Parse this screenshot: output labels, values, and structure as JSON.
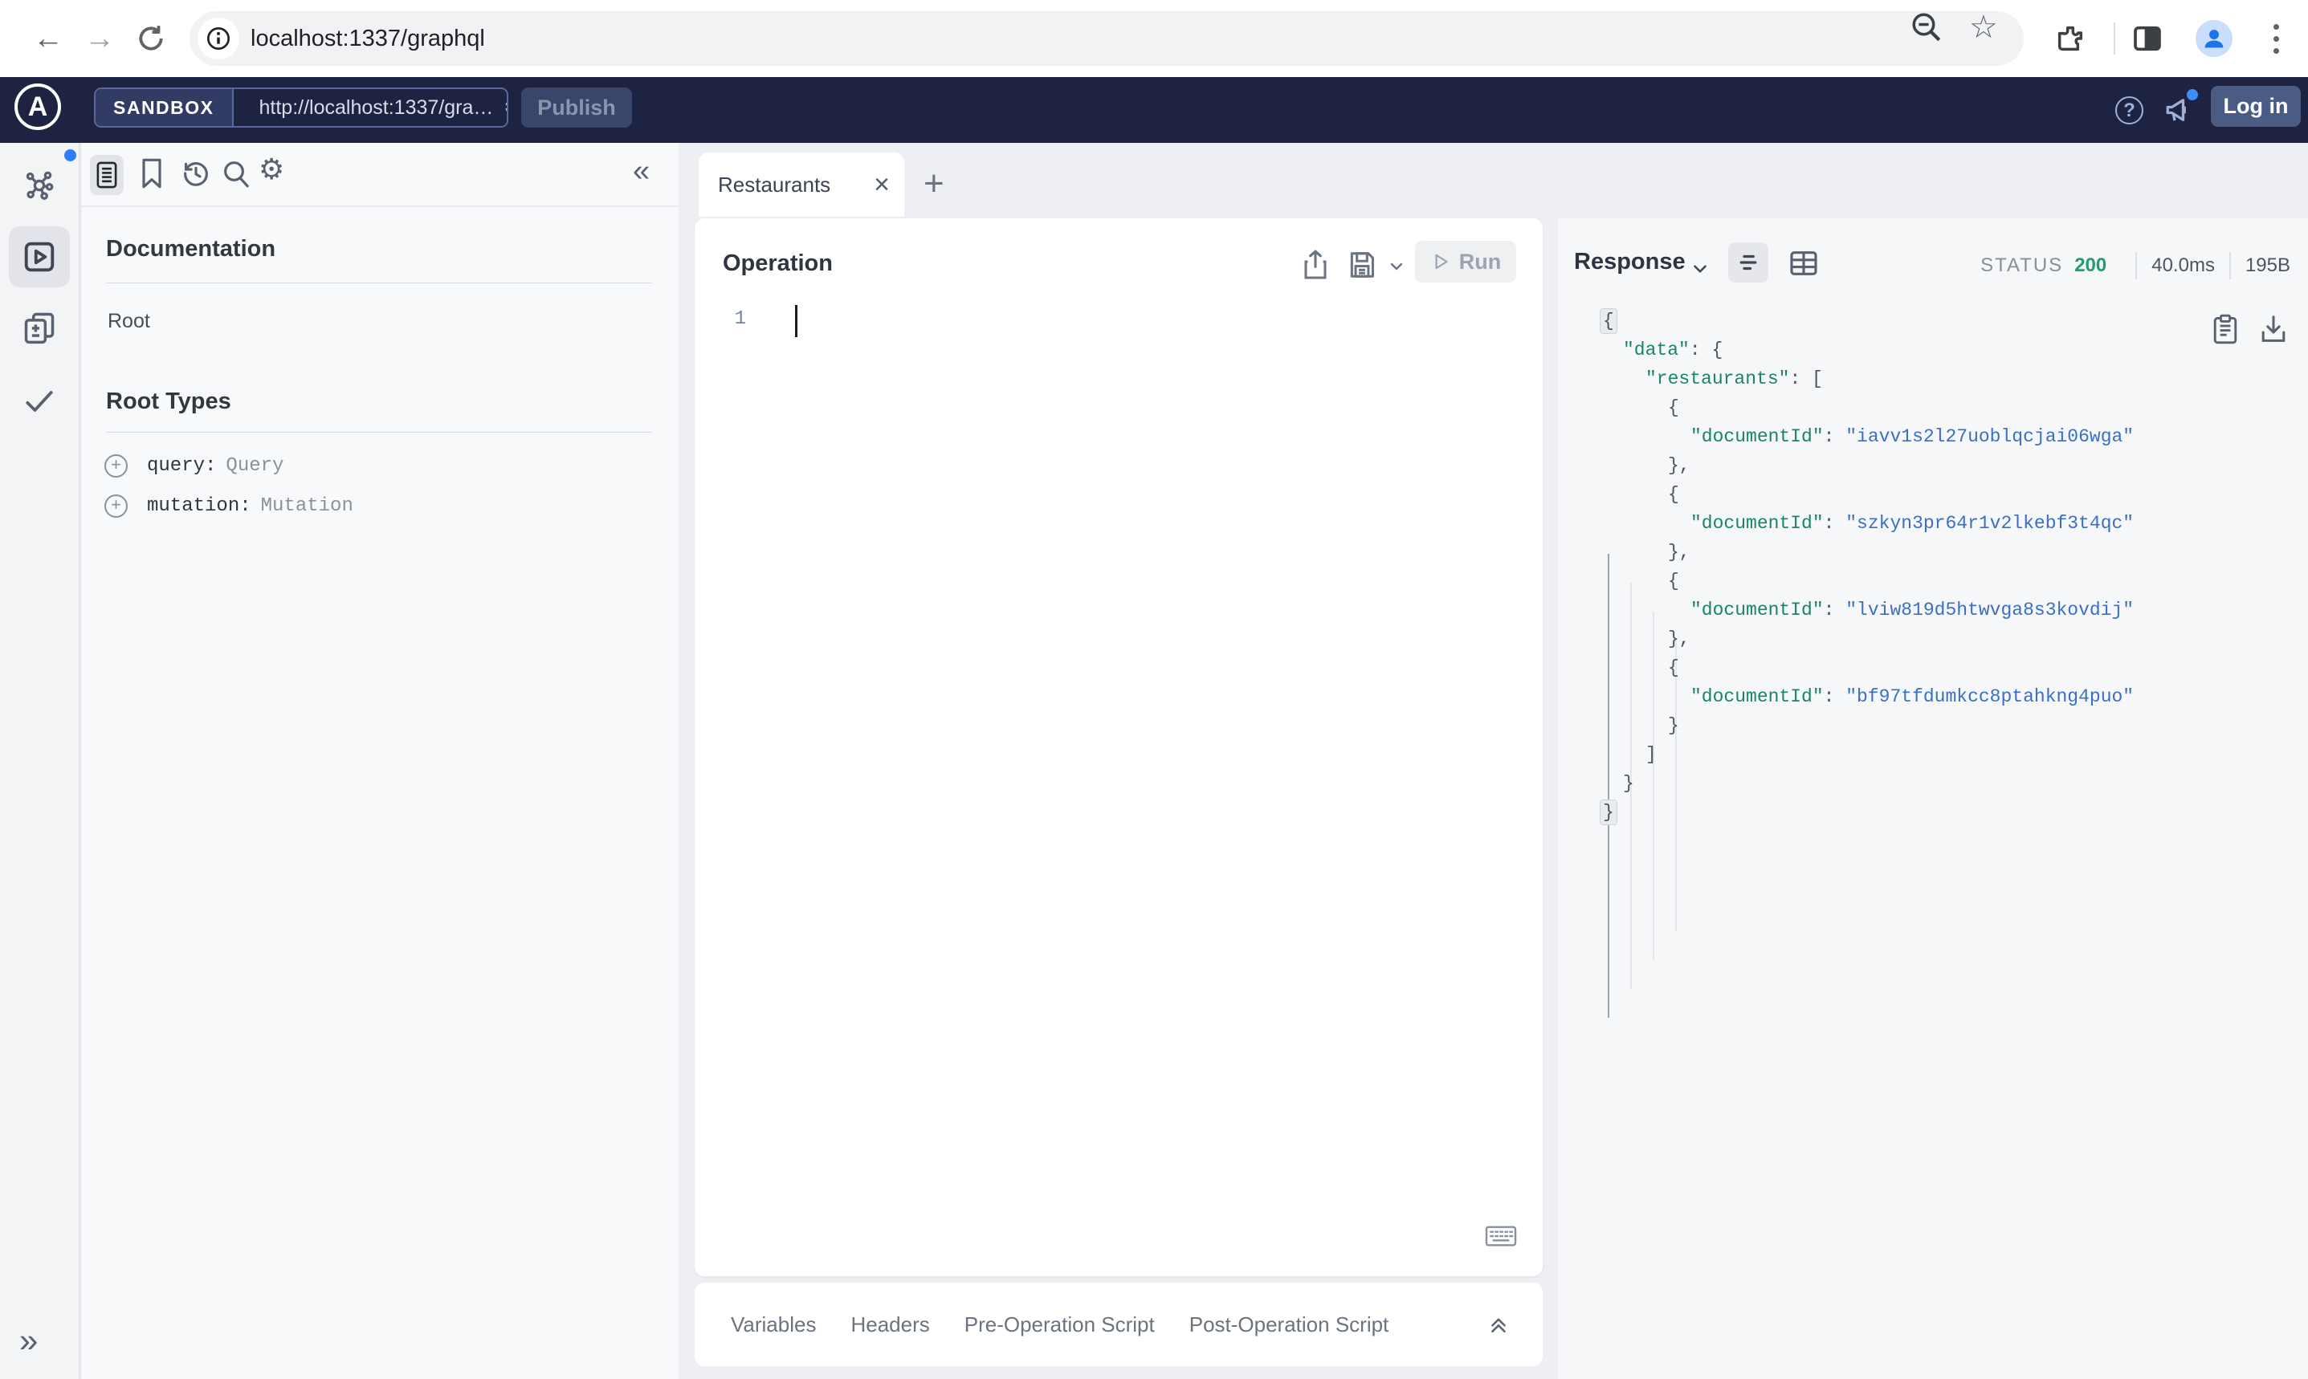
{
  "browser": {
    "url": "localhost:1337/graphql"
  },
  "sandbox_bar": {
    "badge": "SANDBOX",
    "endpoint": "http://localhost:1337/gra…",
    "publish_label": "Publish",
    "help_label": "?",
    "login_label": "Log in"
  },
  "docs": {
    "title": "Documentation",
    "root_link": "Root",
    "section_title": "Root Types",
    "root_types": [
      {
        "field": "query:",
        "type": "Query"
      },
      {
        "field": "mutation:",
        "type": "Mutation"
      }
    ]
  },
  "tabs": {
    "active_label": "Restaurants",
    "close_glyph": "×",
    "new_tab_glyph": "+"
  },
  "operation": {
    "title": "Operation",
    "run_label": "Run",
    "line_number": "1"
  },
  "editor_tabs": {
    "items": [
      "Variables",
      "Headers",
      "Pre-Operation Script",
      "Post-Operation Script"
    ]
  },
  "response": {
    "title": "Response",
    "status_label": "STATUS",
    "status_code": "200",
    "duration": "40.0ms",
    "size": "195B",
    "body": {
      "data": {
        "restaurants": [
          {
            "documentId": "iavv1s2l27uoblqcjai06wga"
          },
          {
            "documentId": "szkyn3pr64r1v2lkebf3t4qc"
          },
          {
            "documentId": "lviw819d5htwvga8s3kovdij"
          },
          {
            "documentId": "bf97tfdumkcc8ptahkng4puo"
          }
        ]
      }
    }
  },
  "rail_glyphs": {
    "expand": "»",
    "collapse": "«"
  },
  "colors": {
    "header_bg": "#1d2340",
    "endpoint_green": "#2dbd6e",
    "status_green": "#1e9e6e",
    "notification_blue": "#2f7df6",
    "json_key": "#1a8466",
    "json_string": "#3a6fc4"
  }
}
